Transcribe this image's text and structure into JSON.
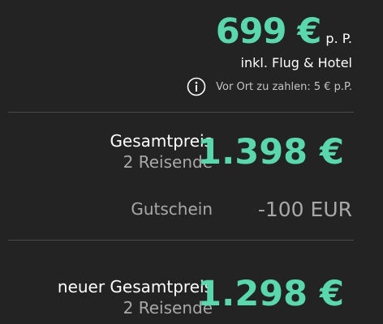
{
  "per_person": {
    "price": "699 €",
    "suffix": "p. P.",
    "includes": "inkl. Flug & Hotel",
    "local_fee": "Vor Ort zu zahlen: 5 € p.P.",
    "info_icon": "info-circle-icon"
  },
  "total": {
    "label": "Gesamtpreis",
    "travelers": "2 Reisende",
    "amount": "1.398 €"
  },
  "voucher": {
    "label": "Gutschein",
    "amount": "-100 EUR"
  },
  "new_total": {
    "label": "neuer Gesamtpreis",
    "travelers": "2 Reisende",
    "amount": "1.298 €"
  },
  "colors": {
    "accent": "#5ad8ad",
    "background": "#232323"
  }
}
